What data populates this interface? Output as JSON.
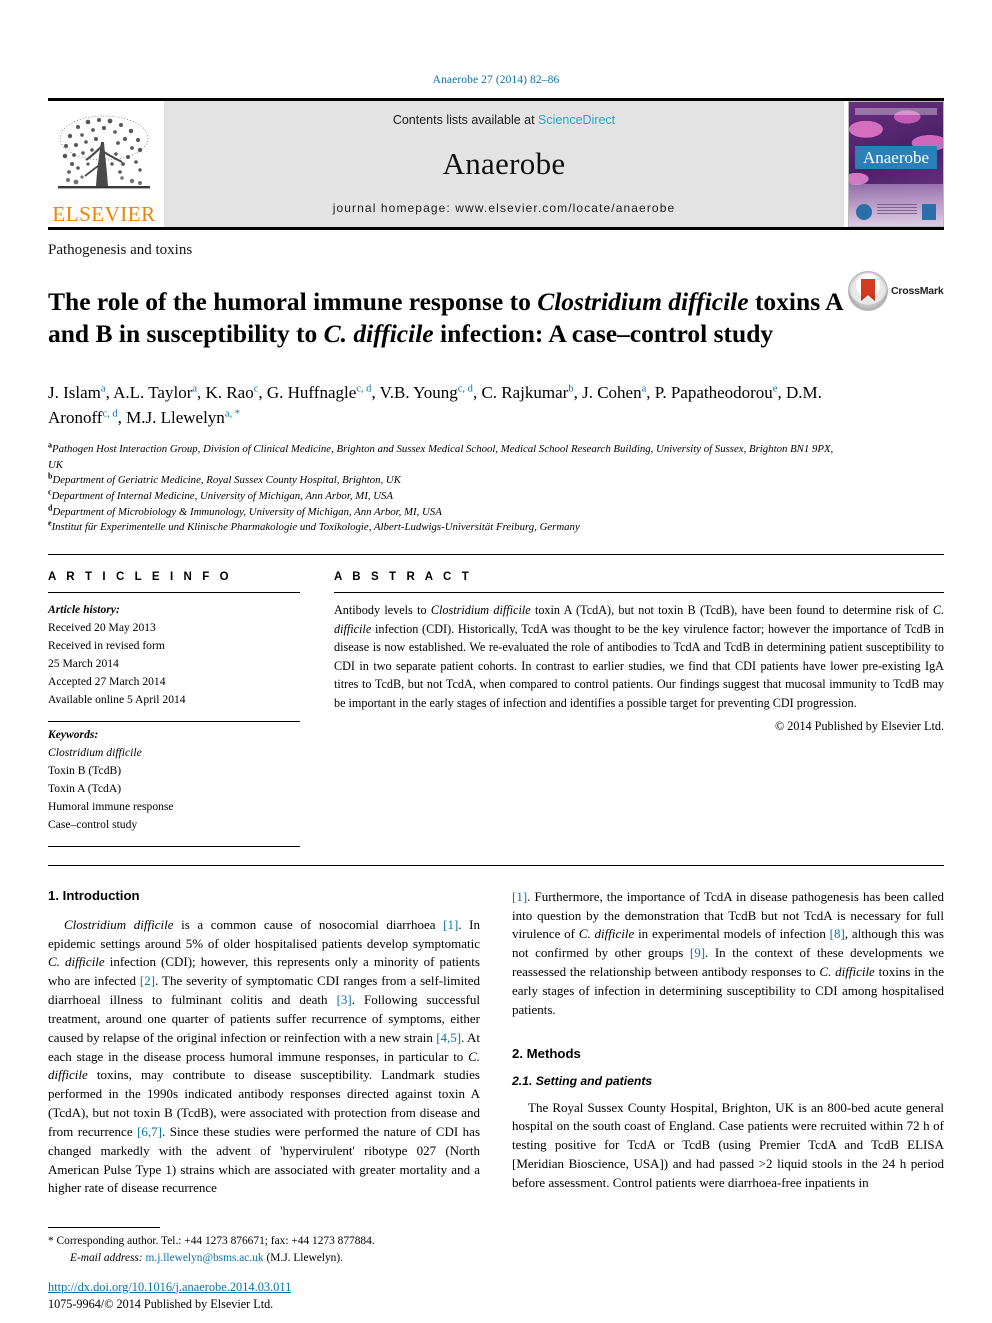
{
  "running_head": "Anaerobe 27 (2014) 82–86",
  "masthead": {
    "publisher_name": "ELSEVIER",
    "contents_prefix": "Contents lists available at ",
    "contents_link": "ScienceDirect",
    "journal_name": "Anaerobe",
    "homepage": "journal homepage: www.elsevier.com/locate/anaerobe",
    "cover_title": "Anaerobe"
  },
  "section_label": "Pathogenesis and toxins",
  "title": {
    "line1_a": "The role of the humoral immune response to ",
    "line1_i": "Clostridium difficile",
    "line1_b": " toxins",
    "line2_a": "A and B in susceptibility to ",
    "line2_i": "C. difficile",
    "line2_b": " infection: A case–control study"
  },
  "crossmark_label": "CrossMark",
  "authors": [
    {
      "name": "J. Islam",
      "sup": "a",
      "sep": ", "
    },
    {
      "name": "A.L. Taylor",
      "sup": "a",
      "sep": ", "
    },
    {
      "name": "K. Rao",
      "sup": "c",
      "sep": ", "
    },
    {
      "name": "G. Huffnagle",
      "sup": "c, d",
      "sep": ", "
    },
    {
      "name": "V.B. Young",
      "sup": "c, d",
      "sep": ", "
    },
    {
      "name": "C. Rajkumar",
      "sup": "b",
      "sep": ", "
    },
    {
      "name": "J. Cohen",
      "sup": "a",
      "sep": ", "
    },
    {
      "name": "P. Papatheodorou",
      "sup": "e",
      "sep": ", "
    },
    {
      "name": "D.M. Aronoff",
      "sup": "c, d",
      "sep": ", "
    },
    {
      "name": "M.J. Llewelyn",
      "sup": "a, *",
      "sep": ""
    }
  ],
  "affiliations": [
    {
      "mark": "a",
      "text": "Pathogen Host Interaction Group, Division of Clinical Medicine, Brighton and Sussex Medical School, Medical School Research Building, University of Sussex, Brighton BN1 9PX, UK"
    },
    {
      "mark": "b",
      "text": "Department of Geriatric Medicine, Royal Sussex County Hospital, Brighton, UK"
    },
    {
      "mark": "c",
      "text": "Department of Internal Medicine, University of Michigan, Ann Arbor, MI, USA"
    },
    {
      "mark": "d",
      "text": "Department of Microbiology & Immunology, University of Michigan, Ann Arbor, MI, USA"
    },
    {
      "mark": "e",
      "text": "Institut für Experimentelle und Klinische Pharmakologie und Toxikologie, Albert-Ludwigs-Universität Freiburg, Germany"
    }
  ],
  "article_info": {
    "heading": "A R T I C L E   I N F O",
    "history_label": "Article history:",
    "history": [
      "Received 20 May 2013",
      "Received in revised form",
      "25 March 2014",
      "Accepted 27 March 2014",
      "Available online 5 April 2014"
    ],
    "keywords_label": "Keywords:",
    "keywords": [
      "Clostridium difficile",
      "Toxin B (TcdB)",
      "Toxin A (TcdA)",
      "Humoral immune response",
      "Case–control study"
    ],
    "keyword_italic_index": 0
  },
  "abstract": {
    "heading": "A B S T R A C T",
    "p1_a": "Antibody levels to ",
    "p1_i1": "Clostridium difficile",
    "p1_b": " toxin A (TcdA), but not toxin B (TcdB), have been found to determine risk of ",
    "p1_i2": "C. difficile",
    "p1_c": " infection (CDI). Historically, TcdA was thought to be the key virulence factor; however the importance of TcdB in disease is now established. We re-evaluated the role of antibodies to TcdA and TcdB in determining patient susceptibility to CDI in two separate patient cohorts. In contrast to earlier studies, we find that CDI patients have lower pre-existing IgA titres to TcdB, but not TcdA, when compared to control patients. Our findings suggest that mucosal immunity to TcdB may be important in the early stages of infection and identifies a possible target for preventing CDI progression.",
    "copyright": "© 2014 Published by Elsevier Ltd."
  },
  "body": {
    "intro_heading": "1. Introduction",
    "intro_p1_a": "",
    "intro_p1_i1": "Clostridium difficile",
    "intro_p1_b": " is a common cause of nosocomial diarrhoea ",
    "intro_p1_r1": "[1]",
    "intro_p1_c": ". In epidemic settings around 5% of older hospitalised patients develop symptomatic ",
    "intro_p1_i2": "C. difficile",
    "intro_p1_d": " infection (CDI); however, this represents only a minority of patients who are infected ",
    "intro_p1_r2": "[2]",
    "intro_p1_e": ". The severity of symptomatic CDI ranges from a self-limited diarrhoeal illness to fulminant colitis and death ",
    "intro_p1_r3": "[3]",
    "intro_p1_f": ". Following successful treatment, around one quarter of patients suffer recurrence of symptoms, either caused by relapse of the original infection or reinfection with a new strain ",
    "intro_p1_r4": "[4,5]",
    "intro_p1_g": ". At each stage in the disease process humoral immune responses, in particular to ",
    "intro_p1_i3": "C. difficile",
    "intro_p1_h": " toxins, may contribute to disease susceptibility. Landmark studies performed in the 1990s indicated antibody responses directed against toxin A (TcdA), but not toxin B (TcdB), were associated with protection from disease and from recurrence ",
    "intro_p1_r5": "[6,7]",
    "intro_p1_j": ". Since these studies were performed the nature of CDI has changed markedly with the advent of 'hypervirulent' ribotype 027 (North American Pulse Type 1) strains which are associated with greater mortality and a higher rate of disease recurrence ",
    "intro_p1_r6": "[1]",
    "intro_p1_k": ". Furthermore, the importance of TcdA in disease pathogenesis has been called into question by the demonstration that TcdB but not TcdA is necessary for full virulence of ",
    "intro_p1_i4": "C. difficile",
    "intro_p1_l": " in experimental models of infection ",
    "intro_p1_r7": "[8]",
    "intro_p1_m": ", although this was not confirmed by other groups ",
    "intro_p1_r8": "[9]",
    "intro_p1_n": ". In the context of these developments we reassessed the relationship between antibody responses to ",
    "intro_p1_i5": "C. difficile",
    "intro_p1_o": " toxins in the early stages of infection in determining susceptibility to CDI among hospitalised patients.",
    "methods_heading": "2. Methods",
    "methods_sub_heading": "2.1. Setting and patients",
    "methods_p1": "The Royal Sussex County Hospital, Brighton, UK is an 800-bed acute general hospital on the south coast of England. Case patients were recruited within 72 h of testing positive for TcdA or TcdB (using Premier TcdA and TcdB ELISA [Meridian Bioscience, USA]) and had passed >2 liquid stools in the 24 h period before assessment. Control patients were diarrhoea-free inpatients in"
  },
  "footnote": {
    "star": "*",
    "corresponding": " Corresponding author. Tel.: +44 1273 876671; fax: +44 1273 877884.",
    "email_label": "E-mail address:",
    "email": "m.j.llewelyn@bsms.ac.uk",
    "email_suffix": " (M.J. Llewelyn)."
  },
  "doi": "http://dx.doi.org/10.1016/j.anaerobe.2014.03.011",
  "issn_line": "1075-9964/© 2014 Published by Elsevier Ltd.",
  "colors": {
    "link_blue": "#0b72a8",
    "sciencedirect_blue": "#2ba6cb",
    "elsevier_orange": "#ef8200",
    "band_grey": "#e3e3e3",
    "crossmark_red": "#d33a20"
  }
}
